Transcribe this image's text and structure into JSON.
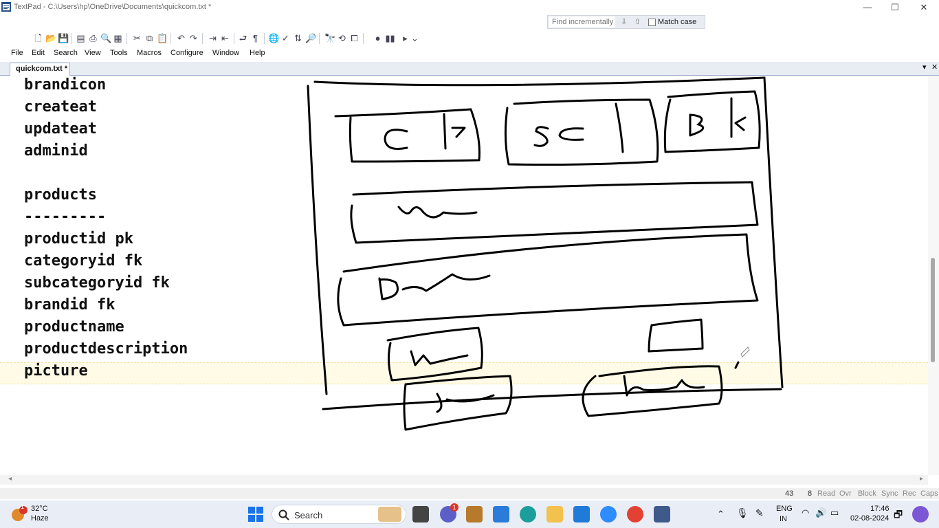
{
  "window": {
    "title": "TextPad - C:\\Users\\hp\\OneDrive\\Documents\\quickcom.txt *",
    "minimize": "—",
    "maximize": "☐",
    "close": "✕"
  },
  "find": {
    "placeholder": "Find incrementally",
    "down_arrow": "⇩",
    "up_arrow": "⇧",
    "match_case_label": "Match case"
  },
  "menu": [
    "File",
    "Edit",
    "Search",
    "View",
    "Tools",
    "Macros",
    "Configure",
    "Window",
    "Help"
  ],
  "tab": {
    "label": "quickcom.txt *",
    "dropdown": "▾",
    "close": "✕"
  },
  "editor": {
    "lines": [
      "brandicon",
      "createat",
      "updateat",
      "adminid",
      "",
      "products",
      "---------",
      "productid pk",
      "categoryid fk",
      "subcategoryid fk",
      "brandid fk",
      "productname",
      "productdescription",
      "picture"
    ],
    "sketch": {
      "box_labels": [
        "C",
        "SC",
        "B"
      ],
      "stroke_color": "#000000"
    }
  },
  "status": {
    "line": "43",
    "col": "8",
    "flags": [
      "Read",
      "Ovr",
      "Block",
      "Sync",
      "Rec",
      "Caps"
    ]
  },
  "taskbar": {
    "weather_temp": "32°C",
    "weather_desc": "Haze",
    "weather_badge": "1",
    "search_label": "Search",
    "lang_top": "ENG",
    "lang_bottom": "IN",
    "time": "17:46",
    "date": "02-08-2024",
    "chat_badge": "1"
  },
  "colors": {
    "accent": "#1a5fb4",
    "current_line": "#fffbe6",
    "taskbar": "#e9eef6"
  }
}
